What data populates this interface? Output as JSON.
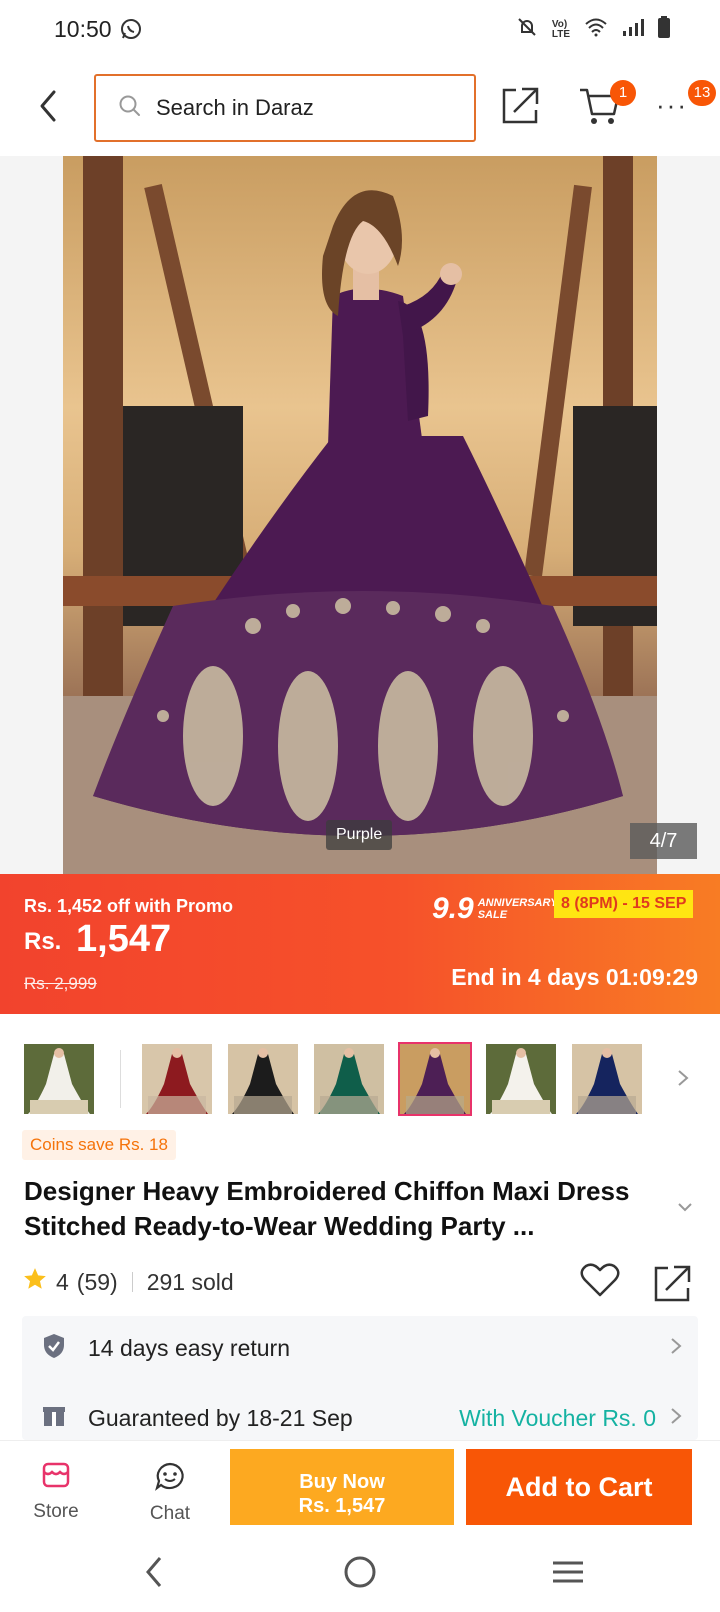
{
  "status_bar": {
    "time": "10:50",
    "icons": [
      "whatsapp-icon",
      "mute-icon",
      "volte-icon",
      "wifi-icon",
      "signal-icon",
      "battery-icon"
    ]
  },
  "header": {
    "search_placeholder": "Search in Daraz",
    "cart_count": "1",
    "more_count": "13"
  },
  "gallery": {
    "color_label": "Purple",
    "counter": "4/7"
  },
  "promo": {
    "off_text": "Rs. 1,452 off with Promo",
    "currency": "Rs.",
    "price": "1,547",
    "old_price": "Rs. 2,999",
    "sale_number": "9.9",
    "sale_small_1": "ANNIVERSARY",
    "sale_small_2": "SALE",
    "sale_dates": "8 (8PM) - 15 SEP",
    "countdown": "End in 4 days 01:09:29"
  },
  "thumbnails": [
    {
      "color": "white",
      "hex": "#f2f0ea"
    },
    {
      "color": "maroon",
      "hex": "#8d1a1f"
    },
    {
      "color": "black",
      "hex": "#1c1c1c"
    },
    {
      "color": "green",
      "hex": "#0f5e4a"
    },
    {
      "color": "purple",
      "hex": "#4d1f55",
      "selected": true
    },
    {
      "color": "white",
      "hex": "#f4f2ec"
    },
    {
      "color": "navy",
      "hex": "#15245e"
    }
  ],
  "coins": "Coins save Rs. 18",
  "product": {
    "title": "Designer Heavy Embroidered Chiffon Maxi Dress Stitched Ready-to-Wear Wedding Party ...",
    "rating": "4",
    "reviews": "(59)",
    "sold": "291 sold"
  },
  "service": {
    "return_text": "14 days easy return",
    "delivery_text": "Guaranteed by 18-21 Sep",
    "voucher_text": "With Voucher Rs. 0"
  },
  "action_bar": {
    "store_label": "Store",
    "chat_label": "Chat",
    "buy_now_line1": "Buy Now",
    "buy_now_line2": "Rs. 1,547",
    "add_to_cart": "Add to Cart"
  },
  "colors": {
    "brand_orange": "#f85606",
    "buy_now": "#fda920",
    "voucher_teal": "#15b2a2",
    "sale_yellow": "#ffe512"
  }
}
